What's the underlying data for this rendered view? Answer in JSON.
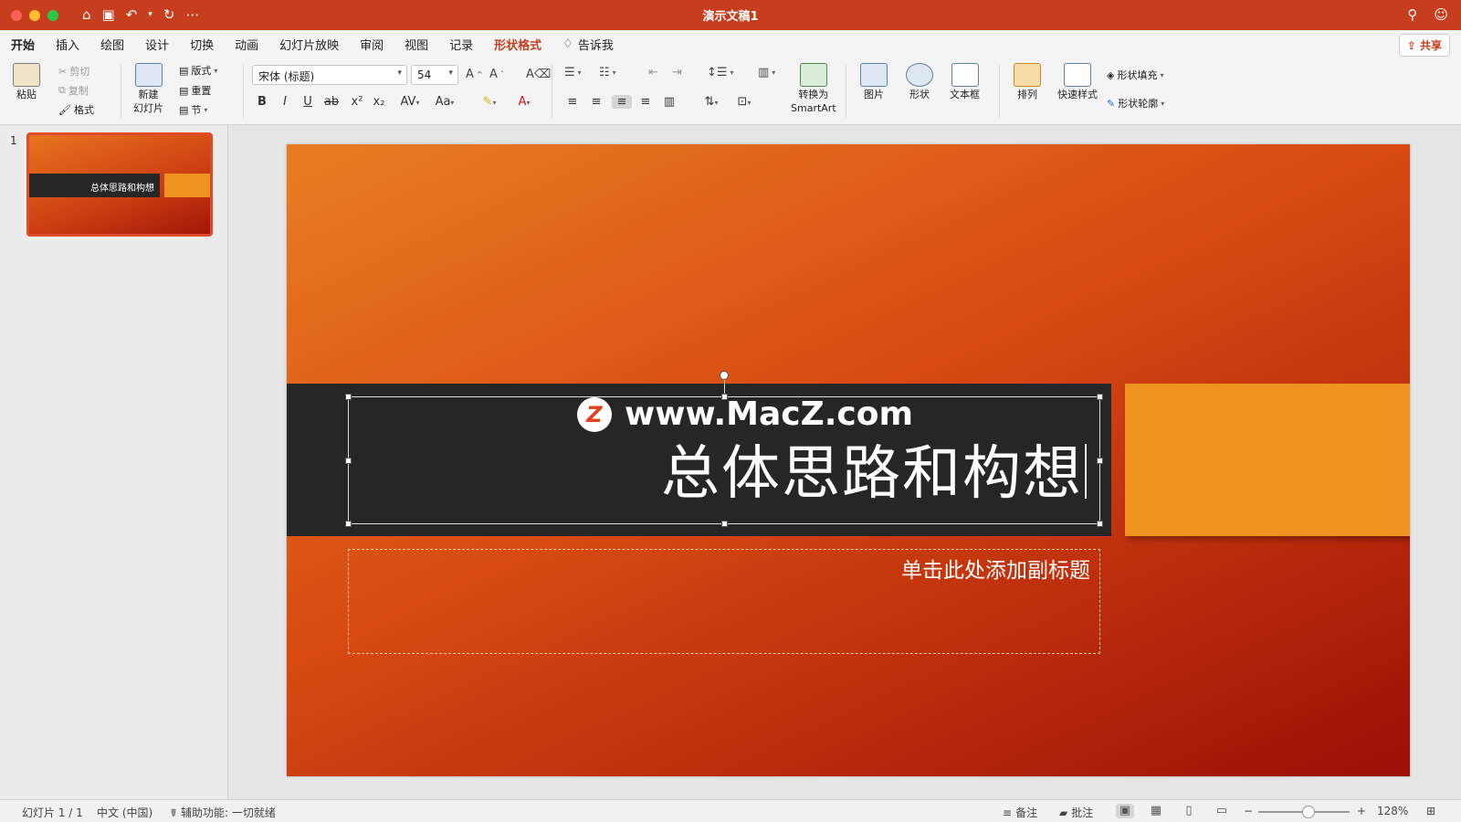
{
  "window": {
    "title": "演示文稿1"
  },
  "tabs": [
    "开始",
    "插入",
    "绘图",
    "设计",
    "切换",
    "动画",
    "幻灯片放映",
    "审阅",
    "视图",
    "记录"
  ],
  "contextual_tab": "形状格式",
  "tell_me": "告诉我",
  "share_label": "共享",
  "ribbon": {
    "paste": "粘贴",
    "cut": "剪切",
    "copy": "复制",
    "format_painter": "格式",
    "new_slide_line1": "新建",
    "new_slide_line2": "幻灯片",
    "layout": "版式",
    "reset": "重置",
    "section": "节",
    "font_name": "宋体 (标题)",
    "font_size": "54",
    "convert_line1": "转换为",
    "convert_line2": "SmartArt",
    "picture": "图片",
    "shape": "形状",
    "textbox": "文本框",
    "arrange": "排列",
    "quick_styles": "快速样式",
    "shape_fill": "形状填充",
    "shape_outline": "形状轮廓"
  },
  "thumbnail": {
    "number": "1",
    "title": "总体思路和构想"
  },
  "slide": {
    "title": "总体思路和构想",
    "subtitle_placeholder": "单击此处添加副标题",
    "watermark": "www.MacZ.com",
    "watermark_logo": "Z"
  },
  "status": {
    "slide_position": "幻灯片 1 / 1",
    "language": "中文 (中国)",
    "accessibility": "辅助功能: 一切就绪",
    "notes": "备注",
    "comments": "批注",
    "zoom": "128%"
  },
  "colors": {
    "accent": "#c63e1d",
    "slide_orange": "#ef9320",
    "band": "#262626"
  }
}
